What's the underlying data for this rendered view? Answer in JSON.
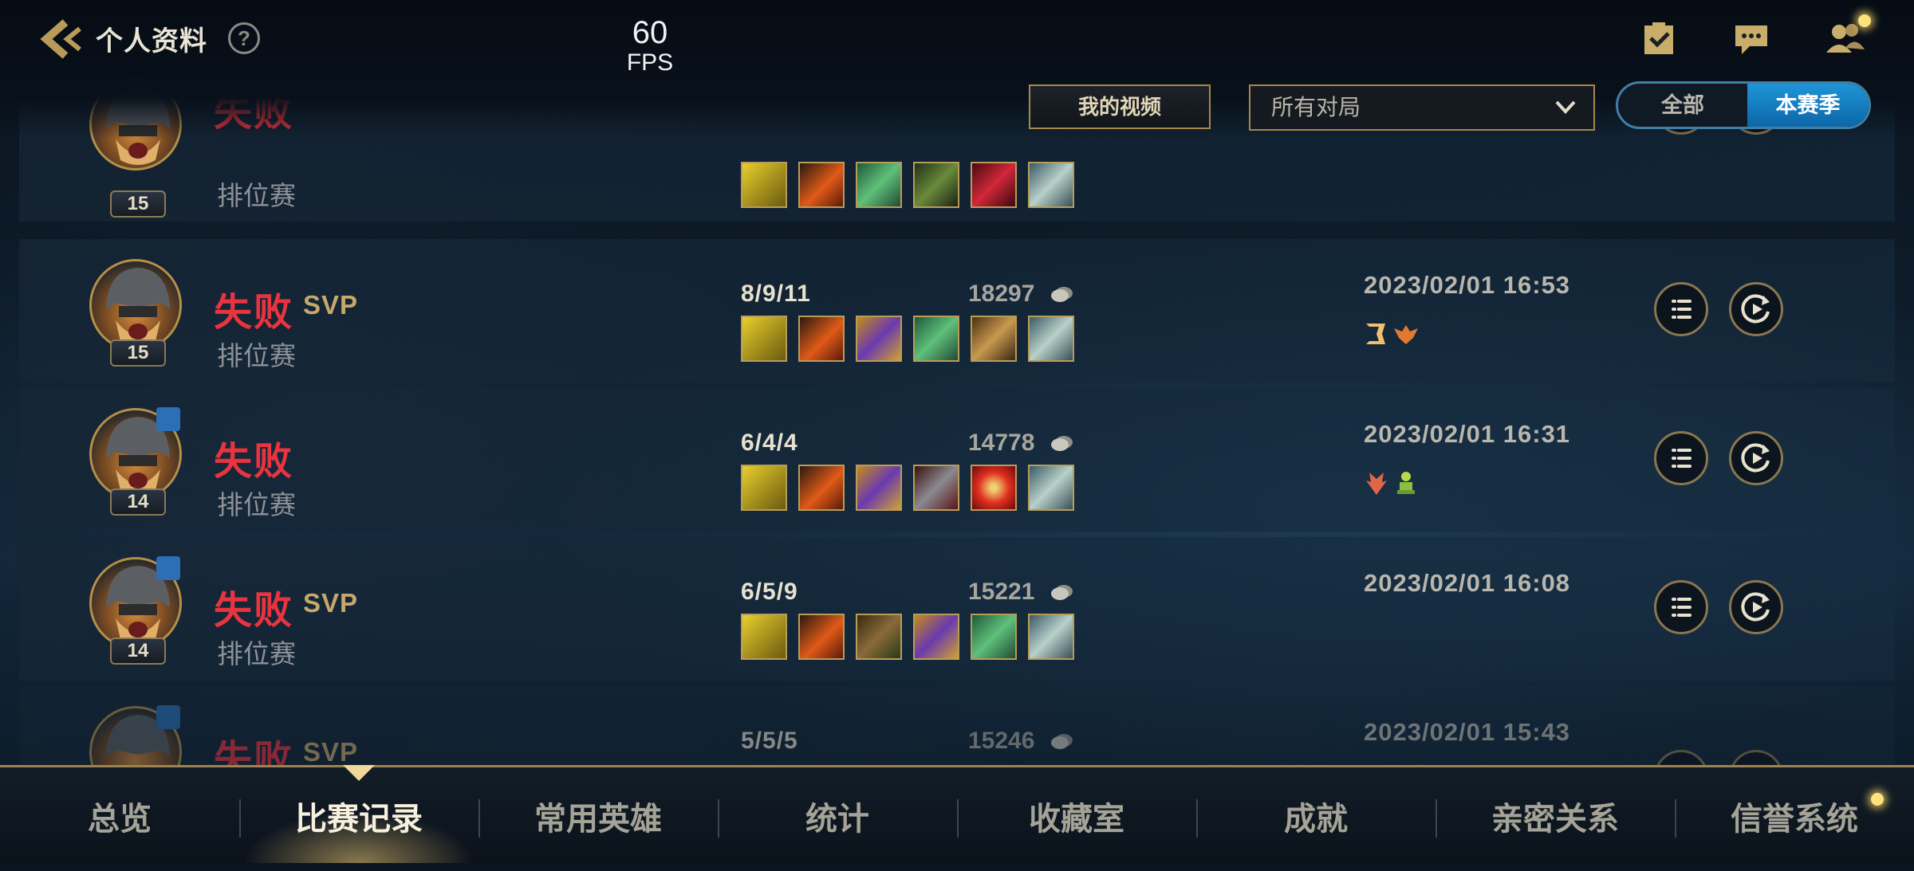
{
  "header": {
    "title": "个人资料",
    "help_symbol": "?",
    "fps_value": "60",
    "fps_label": "FPS",
    "icons": [
      "back-icon",
      "task-checklist-icon",
      "chat-icon",
      "friends-icon"
    ]
  },
  "toolbar": {
    "my_videos": "我的视频",
    "match_filter": "所有对局",
    "season_all": "全部",
    "season_current": "本赛季",
    "active_season_option": "本赛季"
  },
  "matches": [
    {
      "result": "失败",
      "svp": "",
      "mode": "排位赛",
      "level": "15",
      "party": false,
      "kda": "",
      "gold": "",
      "date": "",
      "items": [
        "shield-icon",
        "flame-blade-icon",
        "green-armor-icon",
        "bow-icon",
        "crimson-claw-icon",
        "silver-armor-icon"
      ],
      "badges": []
    },
    {
      "result": "失败",
      "svp": "SVP",
      "mode": "排位赛",
      "level": "15",
      "party": false,
      "kda": "8/9/11",
      "gold": "18297",
      "date": "2023/02/01 16:53",
      "items": [
        "shield-icon",
        "flame-blade-icon",
        "violet-tome-icon",
        "green-armor-icon",
        "golden-helm-icon",
        "silver-armor-icon"
      ],
      "badges": [
        "triple-kill-badge-icon",
        "winged-crest-badge-icon"
      ]
    },
    {
      "result": "失败",
      "svp": "",
      "mode": "排位赛",
      "level": "14",
      "party": true,
      "kda": "6/4/4",
      "gold": "14778",
      "date": "2023/02/01 16:31",
      "items": [
        "shield-icon",
        "flame-blade-icon",
        "violet-tome-icon",
        "dark-plate-icon",
        "fire-orb-icon",
        "silver-armor-icon"
      ],
      "badges": [
        "flame-crest-badge-icon",
        "green-totem-badge-icon"
      ]
    },
    {
      "result": "失败",
      "svp": "SVP",
      "mode": "排位赛",
      "level": "14",
      "party": true,
      "kda": "6/5/9",
      "gold": "15221",
      "date": "2023/02/01 16:08",
      "items": [
        "shield-icon",
        "flame-blade-icon",
        "bronze-gauntlet-icon",
        "violet-tome-icon",
        "green-armor-icon",
        "silver-armor-icon"
      ],
      "badges": []
    },
    {
      "result": "失败",
      "svp": "SVP",
      "mode": "",
      "level": "",
      "party": true,
      "kda": "5/5/5",
      "gold": "15246",
      "date": "2023/02/01 15:43",
      "items": [],
      "badges": []
    }
  ],
  "bottom_nav": {
    "tabs": [
      "总览",
      "比赛记录",
      "常用英雄",
      "统计",
      "收藏室",
      "成就",
      "亲密关系",
      "信誉系统"
    ],
    "active": "比赛记录"
  },
  "colors": {
    "defeat": "#e8343f",
    "svp": "#c7a86a",
    "gold_border": "#a8884a",
    "toggle_active": "#1f95d8"
  }
}
